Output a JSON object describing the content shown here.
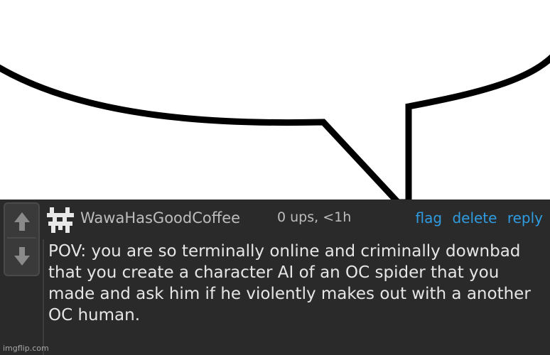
{
  "comment": {
    "username": "WawaHasGoodCoffee",
    "meta": "0 ups, <1h",
    "actions": {
      "flag": "flag",
      "delete": "delete",
      "reply": "reply"
    },
    "text": "POV: you are so terminally online and criminally downbad that you create a character AI of an OC spider that you made and ask him if he violently makes out with a another OC human."
  },
  "watermark": "imgflip.com",
  "icons": {
    "upvote": "arrow-up-icon",
    "downvote": "arrow-down-icon",
    "avatar": "pixel-avatar-icon"
  },
  "colors": {
    "panel": "#2a2a2a",
    "link": "#2f9be0",
    "text": "#e6e6e6"
  }
}
